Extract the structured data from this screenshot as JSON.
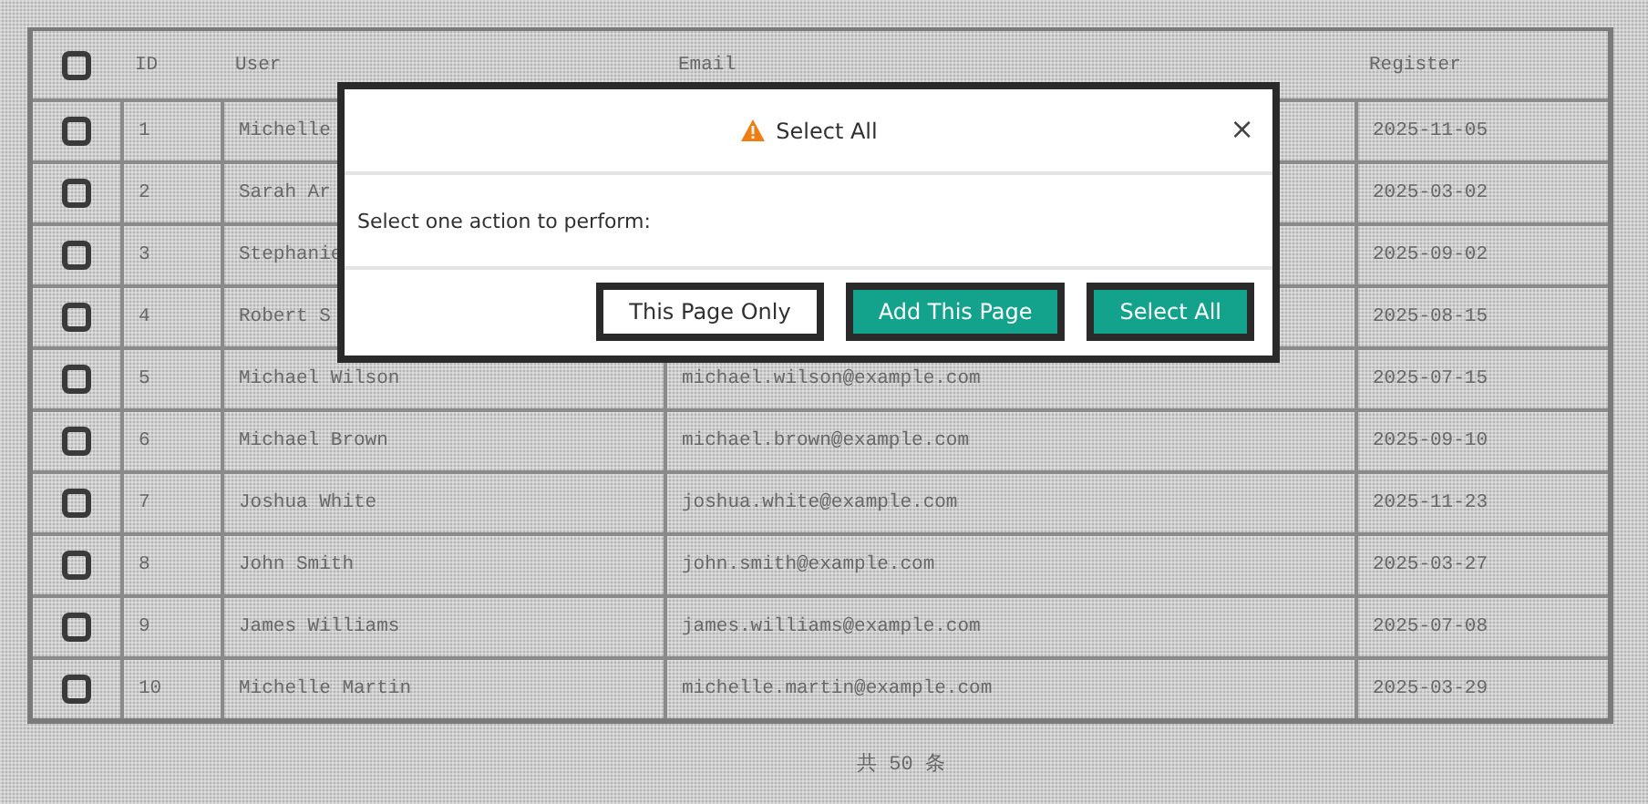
{
  "table": {
    "header_checked": false,
    "columns": [
      "ID",
      "User",
      "Email",
      "Register"
    ],
    "rows": [
      {
        "checked": false,
        "id": "1",
        "user": "Michelle",
        "register": "2025-11-05"
      },
      {
        "checked": false,
        "id": "2",
        "user": "Sarah Ar",
        "register": "2025-03-02"
      },
      {
        "checked": false,
        "id": "3",
        "user": "Stephanie",
        "register": "2025-09-02"
      },
      {
        "checked": false,
        "id": "4",
        "user": "Robert S",
        "register": "2025-08-15"
      },
      {
        "checked": false,
        "id": "5",
        "user": "Michael Wilson",
        "email": "michael.wilson@example.com",
        "register": "2025-07-15"
      },
      {
        "checked": false,
        "id": "6",
        "user": "Michael Brown",
        "email": "michael.brown@example.com",
        "register": "2025-09-10"
      },
      {
        "checked": false,
        "id": "7",
        "user": "Joshua White",
        "email": "joshua.white@example.com",
        "register": "2025-11-23"
      },
      {
        "checked": false,
        "id": "8",
        "user": "John Smith",
        "email": "john.smith@example.com",
        "register": "2025-03-27"
      },
      {
        "checked": false,
        "id": "9",
        "user": "James Williams",
        "email": "james.williams@example.com",
        "register": "2025-07-08"
      },
      {
        "checked": false,
        "id": "10",
        "user": "Michelle Martin",
        "email": "michelle.martin@example.com",
        "register": "2025-03-29"
      }
    ]
  },
  "total": "共 50 条",
  "dialog": {
    "title": "Select All",
    "close": "×",
    "message": "Select one action to perform:",
    "buttons": [
      {
        "label": "This Page Only",
        "kind": "plain"
      },
      {
        "label": "Add This Page",
        "kind": "primary"
      },
      {
        "label": "Select All",
        "kind": "primary"
      }
    ]
  }
}
